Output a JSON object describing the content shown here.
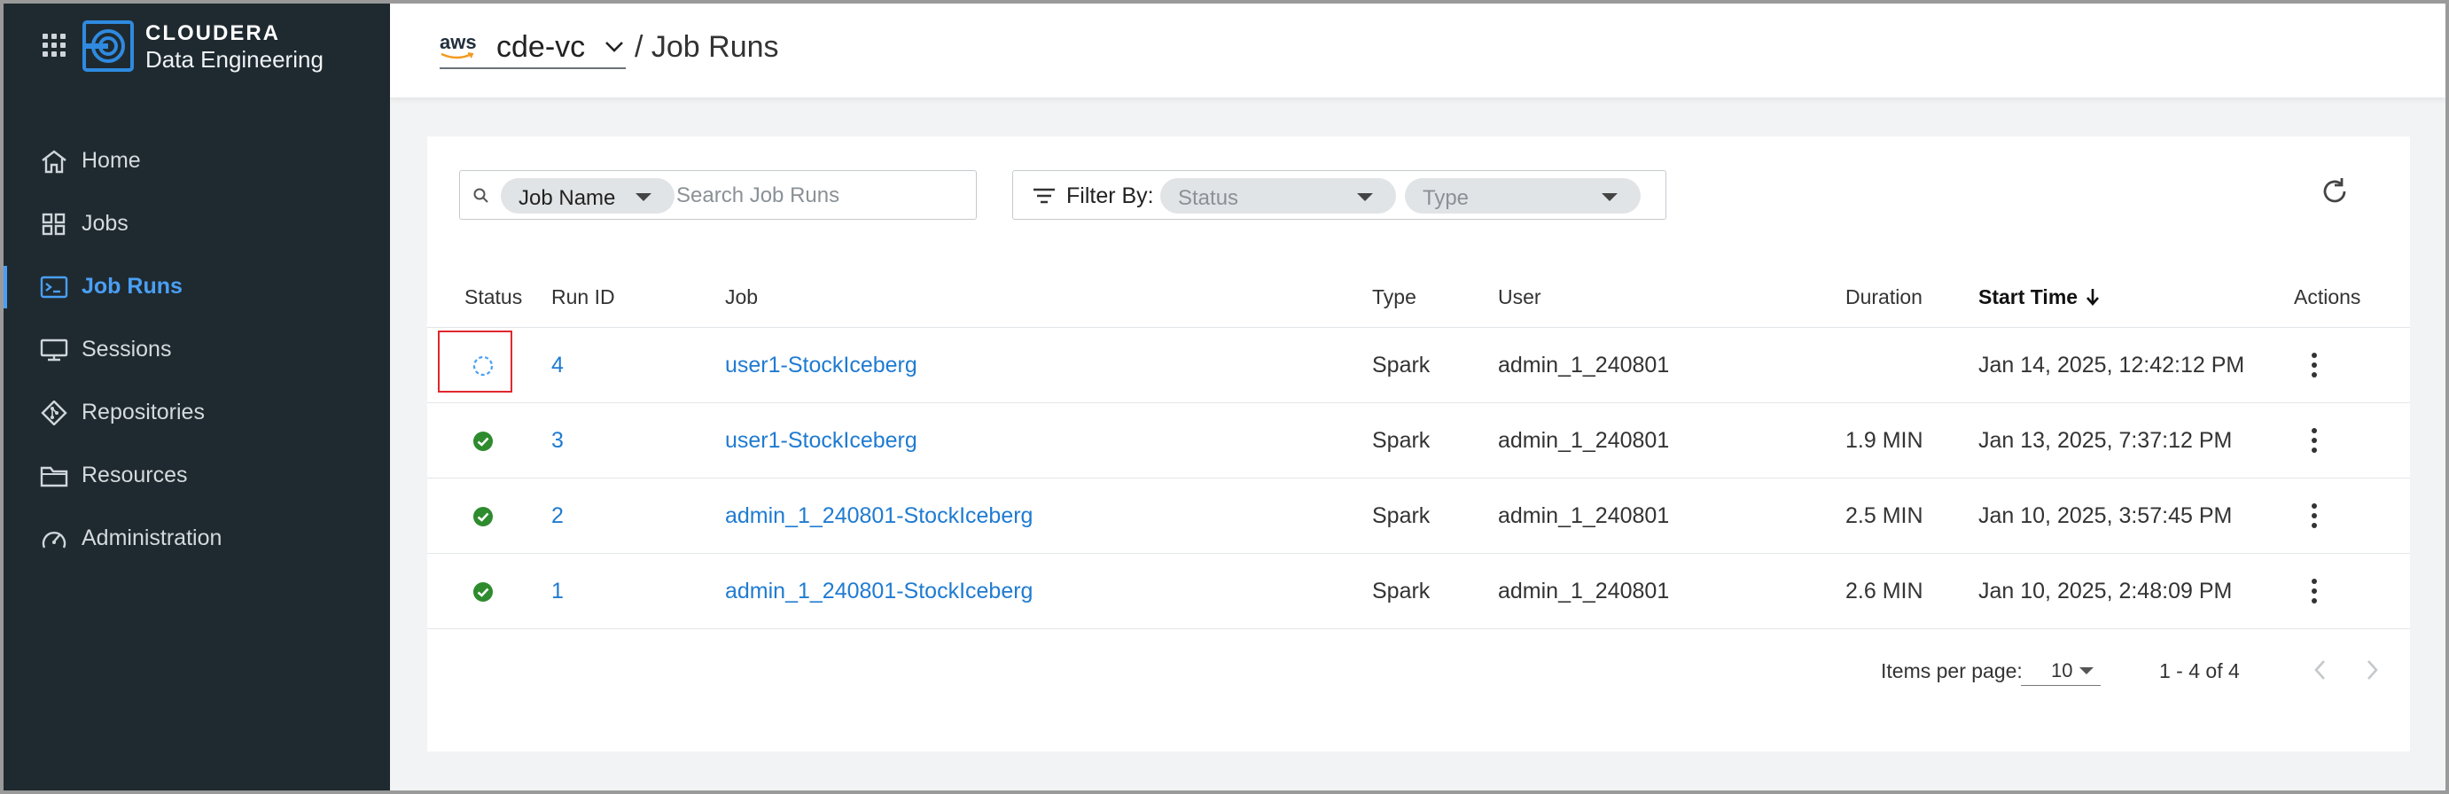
{
  "brand": {
    "line1": "CLOUDERA",
    "line2": "Data Engineering"
  },
  "sidebar": {
    "items": [
      {
        "label": "Home",
        "icon": "home-icon"
      },
      {
        "label": "Jobs",
        "icon": "jobs-grid-icon"
      },
      {
        "label": "Job Runs",
        "icon": "terminal-icon",
        "active": true
      },
      {
        "label": "Sessions",
        "icon": "monitor-icon"
      },
      {
        "label": "Repositories",
        "icon": "git-icon"
      },
      {
        "label": "Resources",
        "icon": "folder-icon"
      },
      {
        "label": "Administration",
        "icon": "gauge-icon"
      }
    ]
  },
  "header": {
    "cloud": "aws",
    "virtual_cluster": "cde-vc",
    "breadcrumb": "/ Job Runs"
  },
  "search": {
    "field_selector": "Job Name",
    "placeholder": "Search Job Runs"
  },
  "filter": {
    "label": "Filter By:",
    "status_placeholder": "Status",
    "type_placeholder": "Type"
  },
  "table": {
    "columns": {
      "status": "Status",
      "run_id": "Run ID",
      "job": "Job",
      "type": "Type",
      "user": "User",
      "duration": "Duration",
      "start_time": "Start Time",
      "actions": "Actions"
    },
    "rows": [
      {
        "status": "running",
        "run_id": "4",
        "job": "user1-StockIceberg",
        "type": "Spark",
        "user": "admin_1_240801",
        "duration": "",
        "start_time": "Jan 14, 2025, 12:42:12 PM"
      },
      {
        "status": "succeeded",
        "run_id": "3",
        "job": "user1-StockIceberg",
        "type": "Spark",
        "user": "admin_1_240801",
        "duration": "1.9 MIN",
        "start_time": "Jan 13, 2025, 7:37:12 PM"
      },
      {
        "status": "succeeded",
        "run_id": "2",
        "job": "admin_1_240801-StockIceberg",
        "type": "Spark",
        "user": "admin_1_240801",
        "duration": "2.5 MIN",
        "start_time": "Jan 10, 2025, 3:57:45 PM"
      },
      {
        "status": "succeeded",
        "run_id": "1",
        "job": "admin_1_240801-StockIceberg",
        "type": "Spark",
        "user": "admin_1_240801",
        "duration": "2.6 MIN",
        "start_time": "Jan 10, 2025, 2:48:09 PM"
      }
    ]
  },
  "pagination": {
    "items_per_page_label": "Items per page:",
    "items_per_page": "10",
    "range": "1 - 4 of 4"
  },
  "colors": {
    "sidebar_bg": "#1f2a30",
    "accent": "#4a9ff5",
    "link": "#1f7bd1",
    "success": "#2e8b2e",
    "highlight": "#e0282e"
  }
}
